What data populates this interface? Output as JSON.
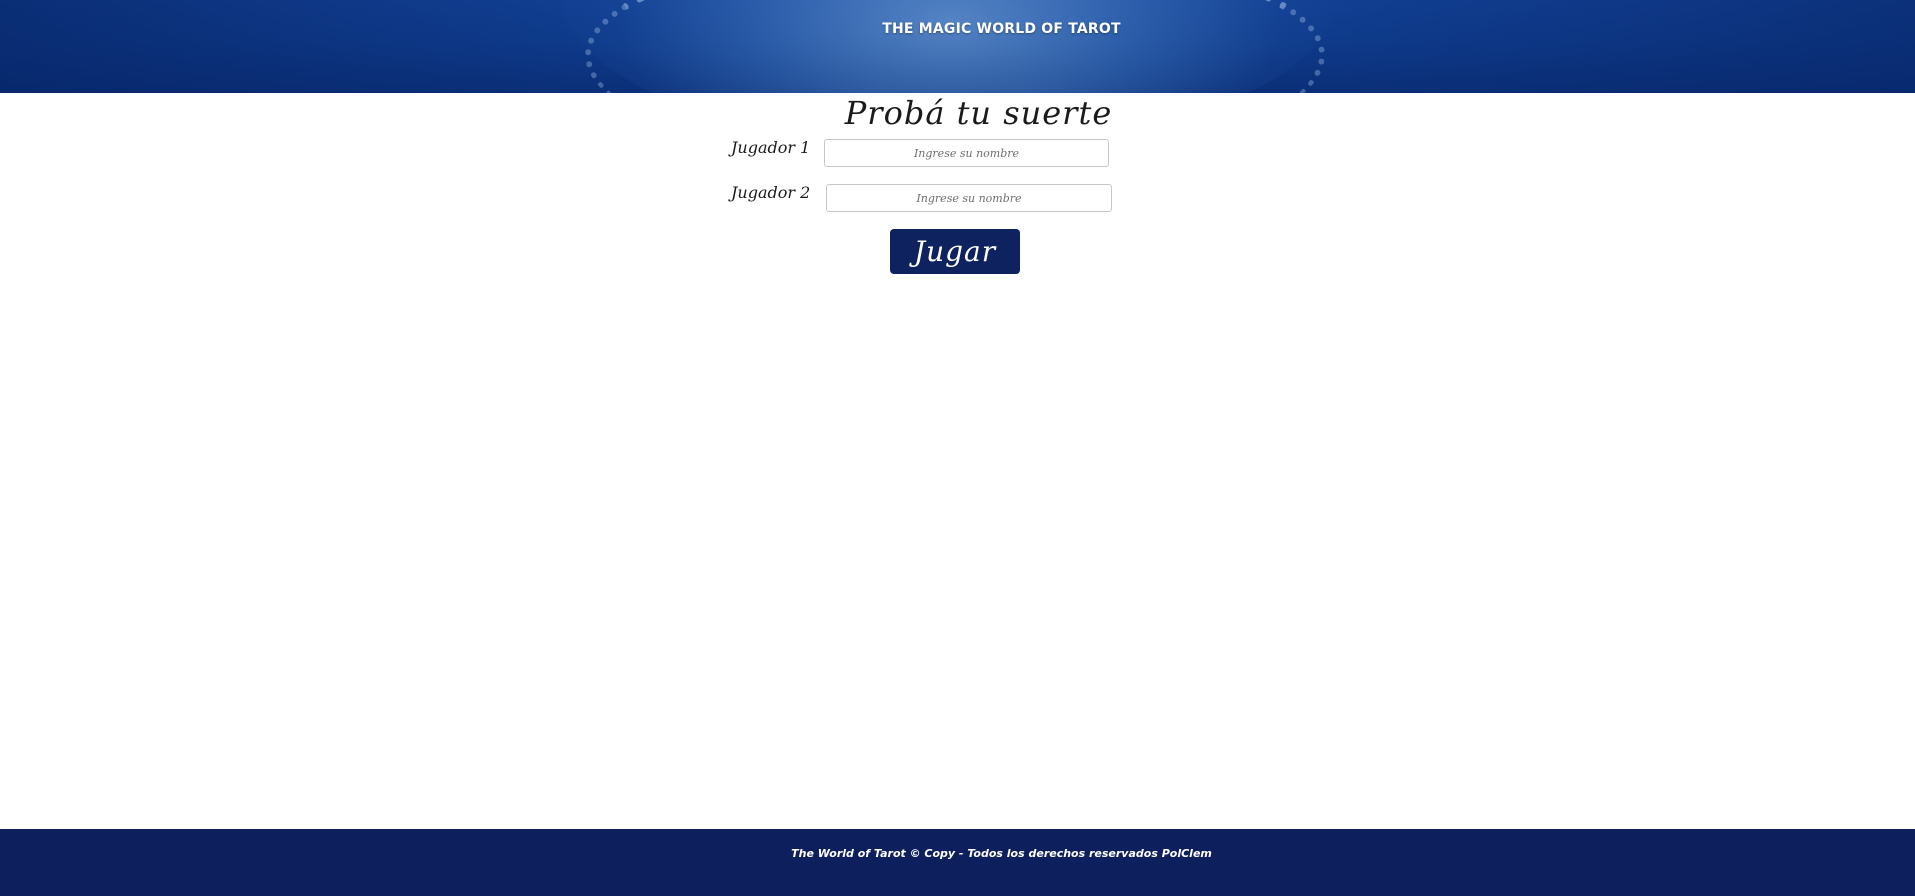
{
  "header": {
    "title": "THE MAGIC WORLD OF TAROT"
  },
  "main": {
    "title": "Probá tu suerte",
    "players": [
      {
        "label": "Jugador 1",
        "placeholder": "Ingrese su nombre",
        "value": ""
      },
      {
        "label": "Jugador 2",
        "placeholder": "Ingrese su nombre",
        "value": ""
      }
    ],
    "play_button_label": "Jugar"
  },
  "footer": {
    "text": "The World of Tarot © Copy - Todos los derechos reservados PolClem"
  },
  "colors": {
    "header_blue": "#0e3a8a",
    "button_navy": "#0f2260",
    "footer_navy": "#0d1f5c",
    "text_dark": "#1a1a1a"
  }
}
